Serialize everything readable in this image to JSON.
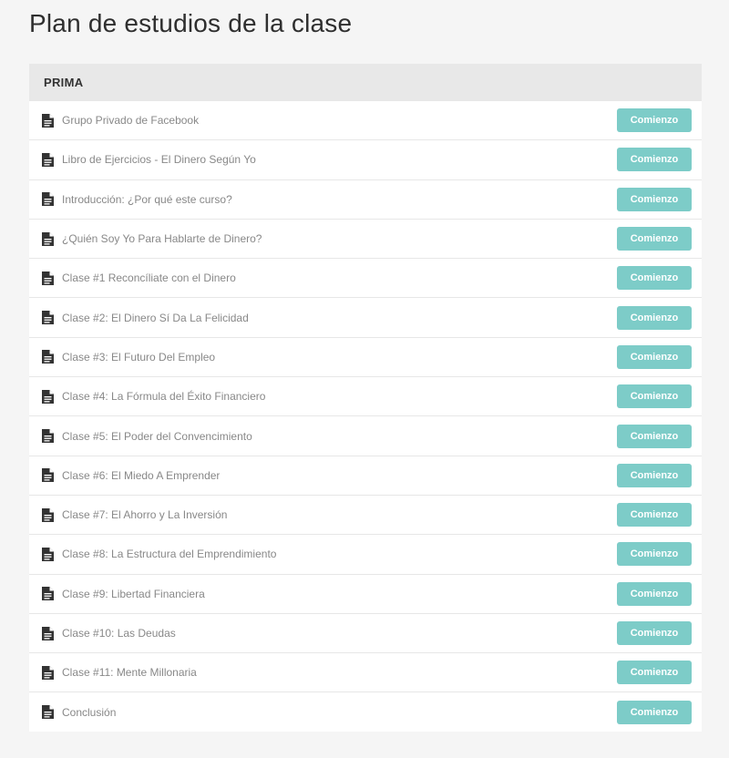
{
  "page": {
    "title": "Plan de estudios de la clase"
  },
  "colors": {
    "background": "#f5f5f5",
    "section_header_bg": "#e8e8e8",
    "button_bg": "#7dccc8",
    "button_text": "#ffffff",
    "lecture_text": "#888888",
    "icon": "#333333"
  },
  "section": {
    "title": "PRIMA",
    "button_label": "Comienzo",
    "item_icon": "document-icon",
    "lectures": [
      {
        "title": "Grupo Privado de Facebook"
      },
      {
        "title": "Libro de Ejercicios - El Dinero Según Yo"
      },
      {
        "title": "Introducción: ¿Por qué este curso?"
      },
      {
        "title": "¿Quién Soy Yo Para Hablarte de Dinero?"
      },
      {
        "title": "Clase #1 Reconcíliate con el Dinero"
      },
      {
        "title": "Clase #2: El Dinero Sí Da La Felicidad"
      },
      {
        "title": "Clase #3: El Futuro Del Empleo"
      },
      {
        "title": "Clase #4: La Fórmula del Éxito Financiero"
      },
      {
        "title": "Clase #5: El Poder del Convencimiento"
      },
      {
        "title": "Clase #6: El Miedo A Emprender"
      },
      {
        "title": "Clase #7: El Ahorro y La Inversión"
      },
      {
        "title": "Clase #8: La Estructura del Emprendimiento"
      },
      {
        "title": "Clase #9: Libertad Financiera"
      },
      {
        "title": "Clase #10: Las Deudas"
      },
      {
        "title": "Clase #11: Mente Millonaria"
      },
      {
        "title": "Conclusión"
      }
    ]
  }
}
